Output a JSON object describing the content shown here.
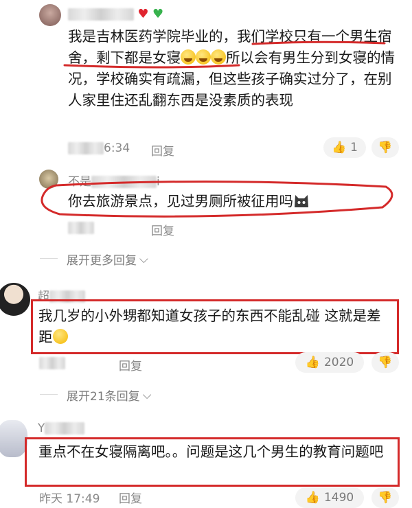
{
  "comments": [
    {
      "id": "c1",
      "username_blur": true,
      "badges": [
        "❤️",
        "💚"
      ],
      "text_parts": [
        "我是吉林医药学院毕业的，我们学校只有一个男生宿舍，剩下都是女寝",
        "所以会有男生分到女寝的情况，学校确实有疏漏，但这些孩子确实过分了，在别人家里住还乱翻东西是没素质的表现"
      ],
      "time_tail": "6:34",
      "reply_label": "回复",
      "likes": "1"
    },
    {
      "id": "c2",
      "username_prefix": "不是",
      "username_tail": "i",
      "text": "你去旅游景点，见过男厕所被征用吗",
      "reply_label": "回复"
    },
    {
      "id": "c3",
      "username_prefix": "超",
      "text": "我几岁的小外甥都知道女孩子的东西不能乱碰 这就是差距",
      "reply_label": "回复",
      "likes": "2020",
      "expand_label": "展开21条回复"
    },
    {
      "id": "c4",
      "username_prefix": "Y",
      "text": "重点不在女寝隔离吧。。问题是这几个男生的教育问题吧",
      "time_prefix": "昨天",
      "time_tail": "17:49",
      "reply_label": "回复",
      "likes": "1490"
    }
  ],
  "expand_more_label": "展开更多回复",
  "colors": {
    "annotation_red": "#d42a2a",
    "meta_gray": "#8a8a8a"
  }
}
